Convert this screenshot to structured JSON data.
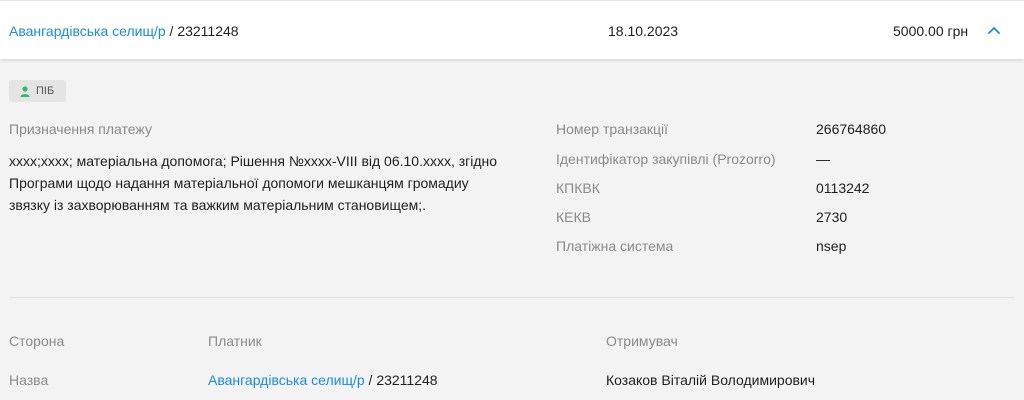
{
  "header": {
    "payer_name": "Авангардівська селищ/р",
    "payer_code": " / 23211248",
    "date": "18.10.2023",
    "amount": "5000.00 грн"
  },
  "badge": {
    "label": "ПІБ",
    "icon": "user-icon",
    "color": "#2eb872"
  },
  "details": {
    "purpose_label": "Призначення платежу",
    "purpose_text": "xxxx;xxxx; матеріальна допомога; Рішення №xxxx-VIII від 06.10.xxxx, згідно Програми щодо надання матеріальної допомоги мешканцям громадиу звязку із захворюванням та важким матеріальним становищем;.",
    "fields": [
      {
        "label": "Номер транзакції",
        "value": "266764860"
      },
      {
        "label": "Ідентифікатор закупівлі (Prozorro)",
        "value": "—"
      },
      {
        "label": "КПКВК",
        "value": "0113242"
      },
      {
        "label": "КЕКВ",
        "value": "2730"
      },
      {
        "label": "Платіжна система",
        "value": "nsep"
      }
    ]
  },
  "parties": {
    "col_side": "Сторона",
    "col_payer": "Платник",
    "col_receiver": "Отримувач",
    "row_name_label": "Назва",
    "payer_name": "Авангардівська селищ/р",
    "payer_code": " / 23211248",
    "receiver_name": "Козаков Віталій Володимирович"
  },
  "colors": {
    "link": "#1a8cd8",
    "muted": "#8a8a8a",
    "background": "#f3f3f3"
  }
}
